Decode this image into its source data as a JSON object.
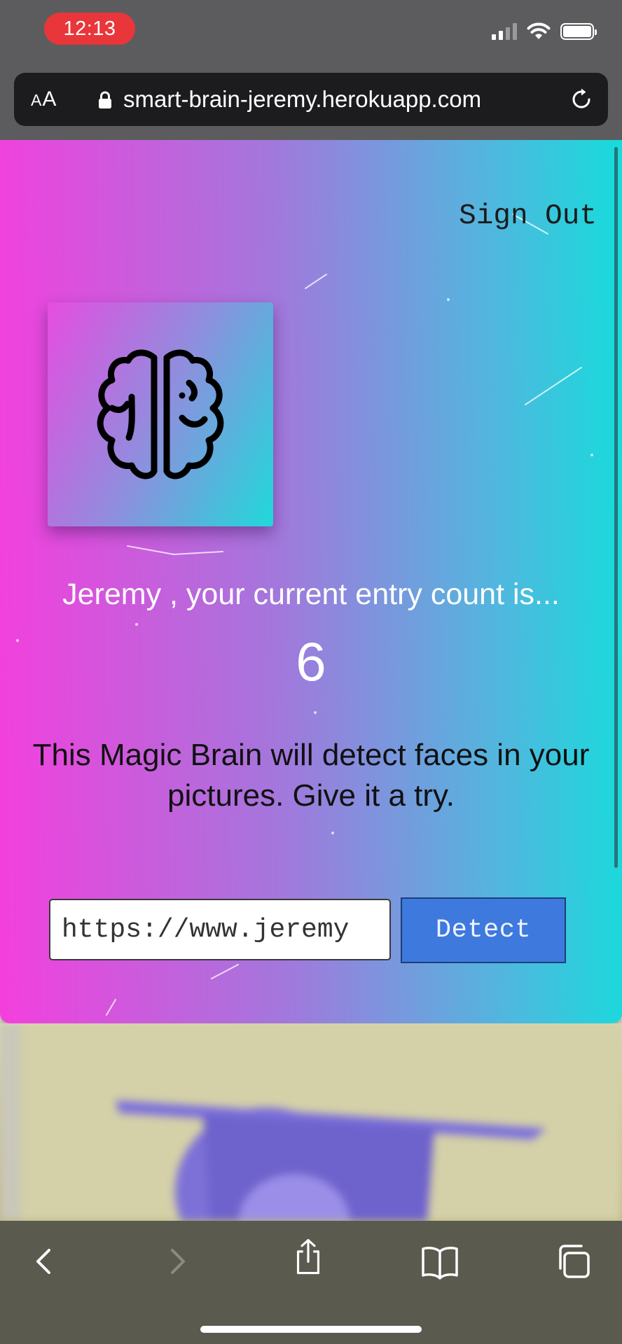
{
  "status_bar": {
    "time": "12:13",
    "icons": [
      "cellular-signal-icon",
      "wifi-icon",
      "battery-icon"
    ]
  },
  "browser": {
    "text_size_label_small": "A",
    "text_size_label_large": "A",
    "url": "smart-brain-jeremy.herokuapp.com",
    "icons": {
      "lock": "lock-icon",
      "reload": "reload-icon"
    }
  },
  "page": {
    "signout_label": "Sign Out",
    "logo_icon": "brain-icon",
    "entry_message": "Jeremy , your current entry count is...",
    "entry_count": "6",
    "tagline": "This Magic Brain will detect faces in your pictures. Give it a try.",
    "image_url_value": "https://www.jeremy",
    "detect_label": "Detect",
    "colors": {
      "gradient_start": "#f43fdd",
      "gradient_end": "#16dcdc",
      "detect_button": "#3e79dd"
    }
  },
  "toolbar": {
    "icons": [
      "back-icon",
      "forward-icon",
      "share-icon",
      "bookmarks-icon",
      "tabs-icon"
    ]
  }
}
